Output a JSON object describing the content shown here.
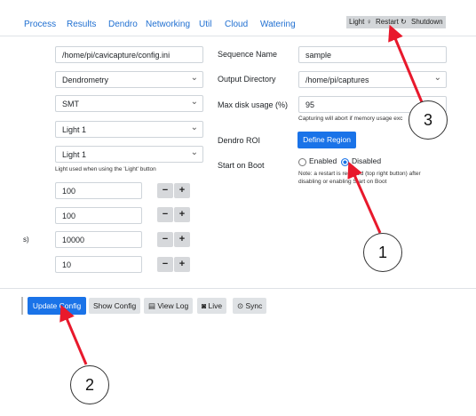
{
  "nav": {
    "items": [
      "Process",
      "Results",
      "Dendro",
      "Networking",
      "Util",
      "Cloud",
      "Watering"
    ]
  },
  "top_buttons": {
    "light": "Light",
    "restart": "Restart",
    "shutdown": "Shutdown"
  },
  "left": {
    "config_path": "/home/pi/cavicapture/config.ini",
    "mode": "Dendrometry",
    "smt": "SMT",
    "light_a": "Light 1",
    "light_b": "Light 1",
    "light_help": "Light used when using the 'Light' button",
    "steppers": [
      {
        "value": "100",
        "side_label": ""
      },
      {
        "value": "100",
        "side_label": ""
      },
      {
        "value": "10000",
        "side_label": "s)"
      },
      {
        "value": "10",
        "side_label": ""
      }
    ],
    "minus": "−",
    "plus": "+"
  },
  "right": {
    "sequence_label": "Sequence Name",
    "sequence_value": "sample",
    "output_label": "Output Directory",
    "output_value": "/home/pi/captures",
    "disk_label": "Max disk usage (%)",
    "disk_value": "95",
    "disk_help": "Capturing will abort if memory usage exc",
    "dendro_label": "Dendro ROI",
    "define_region": "Define Region",
    "boot_label": "Start on Boot",
    "enabled": "Enabled",
    "disabled": "Disabled",
    "note_line1": "Note: a restart is required (top right button) after",
    "note_line2": "disabling or enabling Start on Boot"
  },
  "bottom": {
    "update_config": "Update Config",
    "show_config": "Show Config",
    "view_log": "View Log",
    "live": "Live",
    "sync": "Sync"
  },
  "callouts": [
    "1",
    "2",
    "3"
  ],
  "colors": {
    "accent": "#1a73e8",
    "arrow": "#e8192c",
    "nav_link": "#1f6fd1"
  }
}
